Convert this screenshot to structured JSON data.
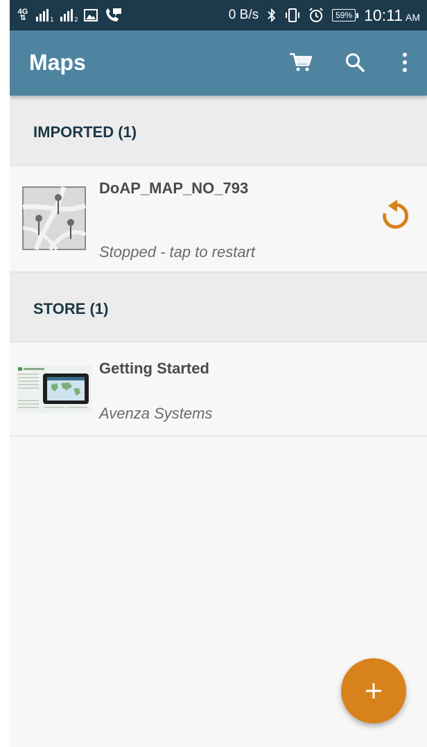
{
  "status_bar": {
    "network": "4G",
    "speed": "0 B/s",
    "battery": "59%",
    "time": "10:11",
    "ampm": "AM"
  },
  "app_bar": {
    "title": "Maps",
    "icons": [
      "cart-icon",
      "search-icon",
      "more-vert-icon"
    ]
  },
  "sections": {
    "imported": {
      "header": "IMPORTED (1)",
      "item": {
        "title": "DoAP_MAP_NO_793",
        "subtitle": "Stopped - tap to restart",
        "action_icon": "restart-icon"
      }
    },
    "store": {
      "header": "STORE (1)",
      "item": {
        "title": "Getting Started",
        "subtitle": "Avenza Systems"
      }
    }
  },
  "fab": {
    "icon": "plus-icon"
  },
  "colors": {
    "status_bar": "#1d3a4c",
    "app_bar": "#4f84a1",
    "accent": "#d8821c",
    "section_header_text": "#1c3746"
  }
}
